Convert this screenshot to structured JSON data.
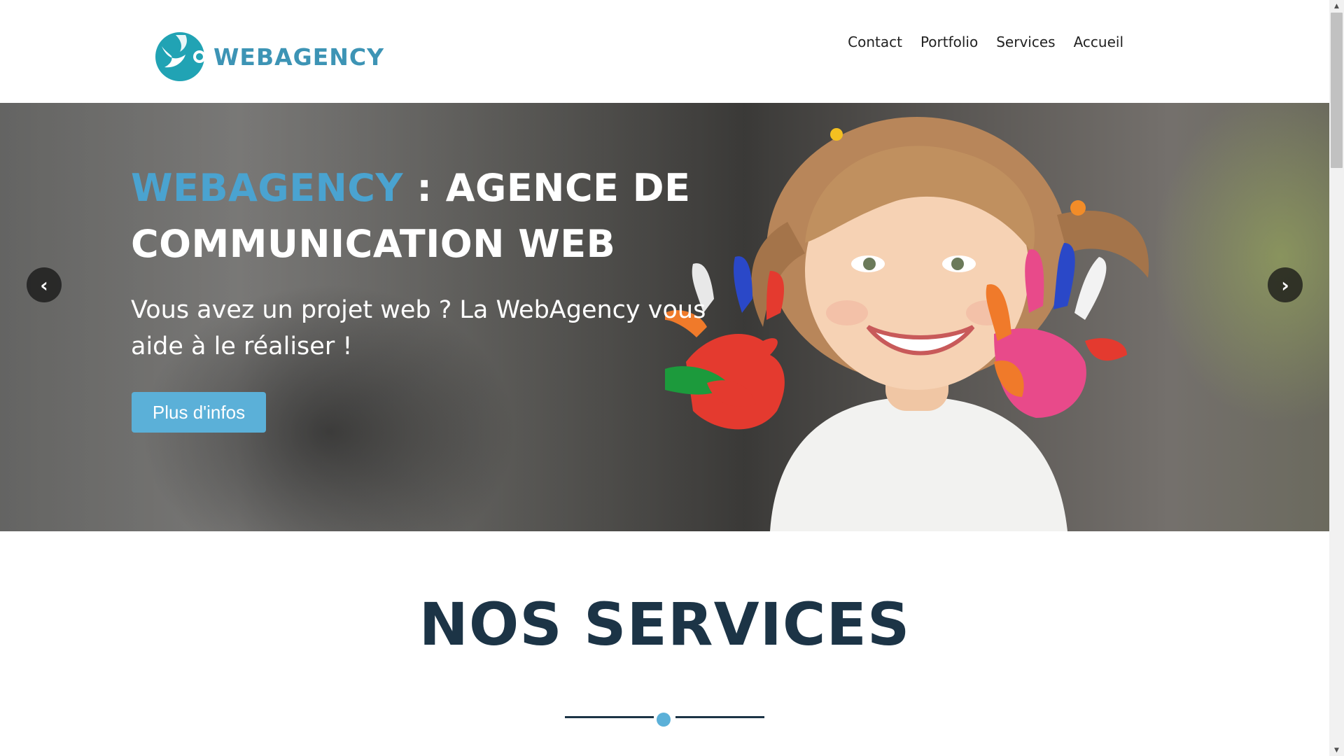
{
  "header": {
    "logo_text": "WEBAGENCY",
    "nav": [
      {
        "label": "Contact"
      },
      {
        "label": "Portfolio"
      },
      {
        "label": "Services"
      },
      {
        "label": "Accueil"
      }
    ]
  },
  "hero": {
    "title_brand": "WEBAGENCY",
    "title_rest": " : AGENCE DE COMMUNICATION WEB",
    "subtitle": "Vous avez un projet web ? La WebAgency vous aide à le réaliser !",
    "button_label": "Plus d'infos",
    "prev_icon": "‹",
    "next_icon": "›"
  },
  "services": {
    "title": "NOS SERVICES"
  },
  "colors": {
    "accent": "#5bb0d8",
    "brand_blue": "#3d94b5",
    "dark_navy": "#1c3446"
  },
  "icons": [
    "logo-mark-icon",
    "chevron-left-icon",
    "chevron-right-icon",
    "scroll-up-icon",
    "scroll-down-icon"
  ]
}
